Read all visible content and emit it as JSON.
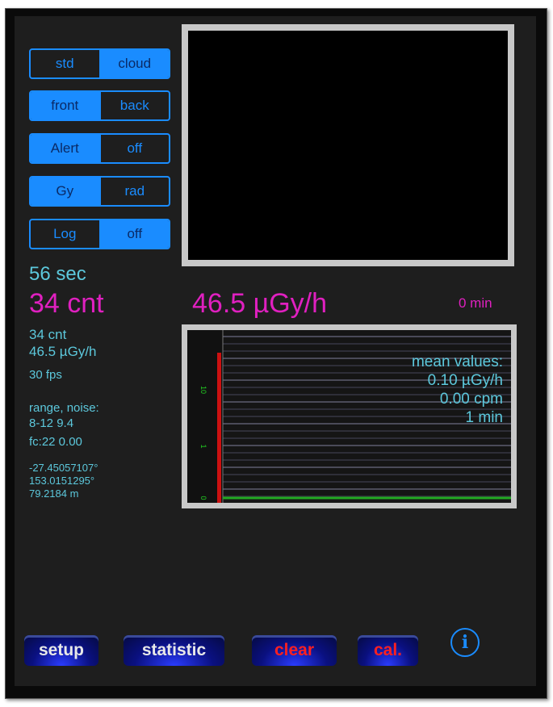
{
  "toggles": [
    {
      "left": "std",
      "right": "cloud",
      "selected": "right"
    },
    {
      "left": "front",
      "right": "back",
      "selected": "left"
    },
    {
      "left": "Alert",
      "right": "off",
      "selected": "left"
    },
    {
      "left": "Gy",
      "right": "rad",
      "selected": "left"
    },
    {
      "left": "Log",
      "right": "off",
      "selected": "right"
    }
  ],
  "status": {
    "elapsed": "56 sec",
    "count_large": "34 cnt",
    "dose_large": "46.5 µGy/h",
    "minutes": "0 min"
  },
  "details": {
    "count": "34 cnt",
    "dose": "46.5 µGy/h",
    "fps": "30 fps",
    "range_label": "range, noise:",
    "range_value": "8-12 9.4",
    "fc": "fc:22 0.00",
    "latitude": "-27.45057107°",
    "longitude": "153.0151295°",
    "altitude": "79.2184 m"
  },
  "graph": {
    "mean_label": "mean values:",
    "mean_dose": "0.10 µGy/h",
    "mean_cpm": "0.00 cpm",
    "window": "1 min",
    "axis_ticks": [
      "10",
      "1",
      "0"
    ],
    "bar_color": "#cc1111",
    "baseline_color": "#22aa22"
  },
  "buttons": {
    "setup": "setup",
    "statistic": "statistic",
    "clear": "clear",
    "cal": "cal.",
    "info": "i"
  },
  "colors": {
    "accent": "#1a8cff",
    "cyan": "#5cc8dc",
    "magenta": "#e020c0"
  }
}
